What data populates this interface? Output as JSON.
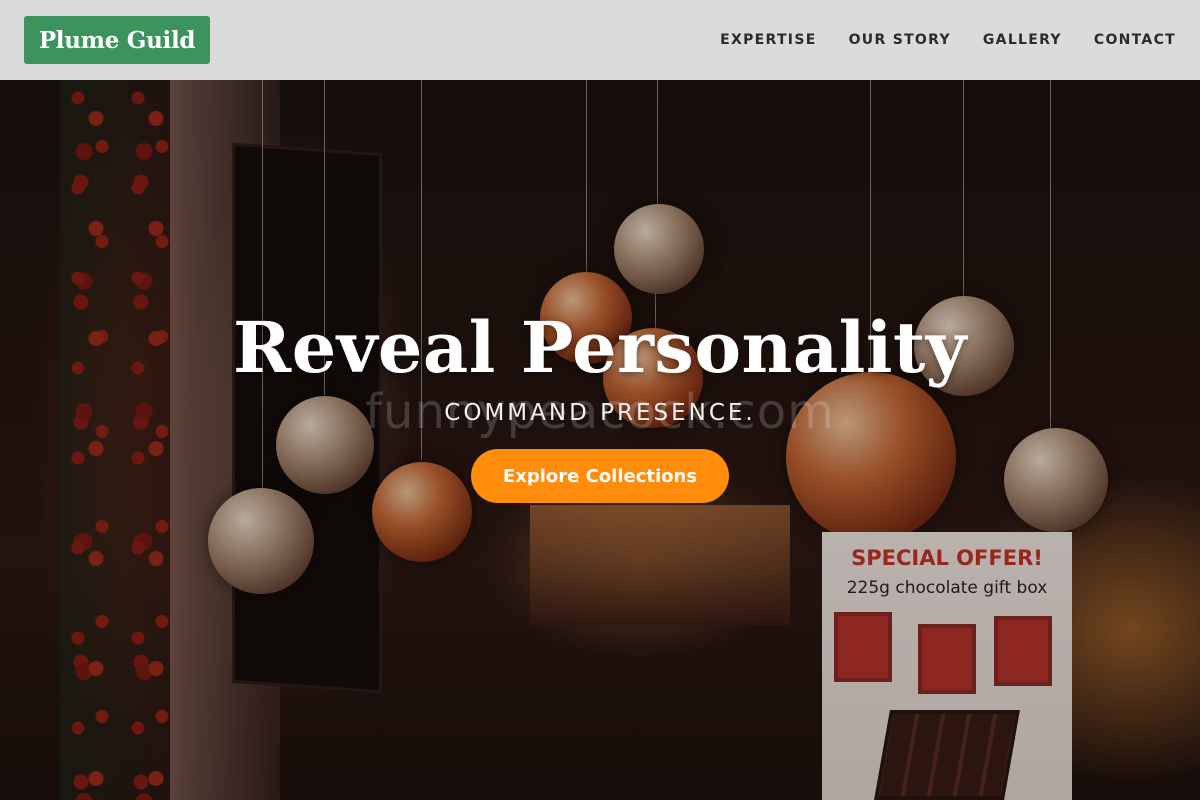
{
  "brand": {
    "name": "Plume Guild",
    "color": "#3c935e"
  },
  "nav": {
    "items": [
      {
        "label": "EXPERTISE"
      },
      {
        "label": "OUR STORY"
      },
      {
        "label": "GALLERY"
      },
      {
        "label": "CONTACT"
      }
    ]
  },
  "hero": {
    "title": "Reveal Personality",
    "subtitle": "COMMAND PRESENCE.",
    "cta_label": "Explore Collections",
    "cta_color": "#ff8c0a",
    "watermark": "funnypeacock.com",
    "offer_sign": {
      "title": "SPECIAL OFFER!",
      "subtitle": "225g chocolate gift box"
    }
  }
}
